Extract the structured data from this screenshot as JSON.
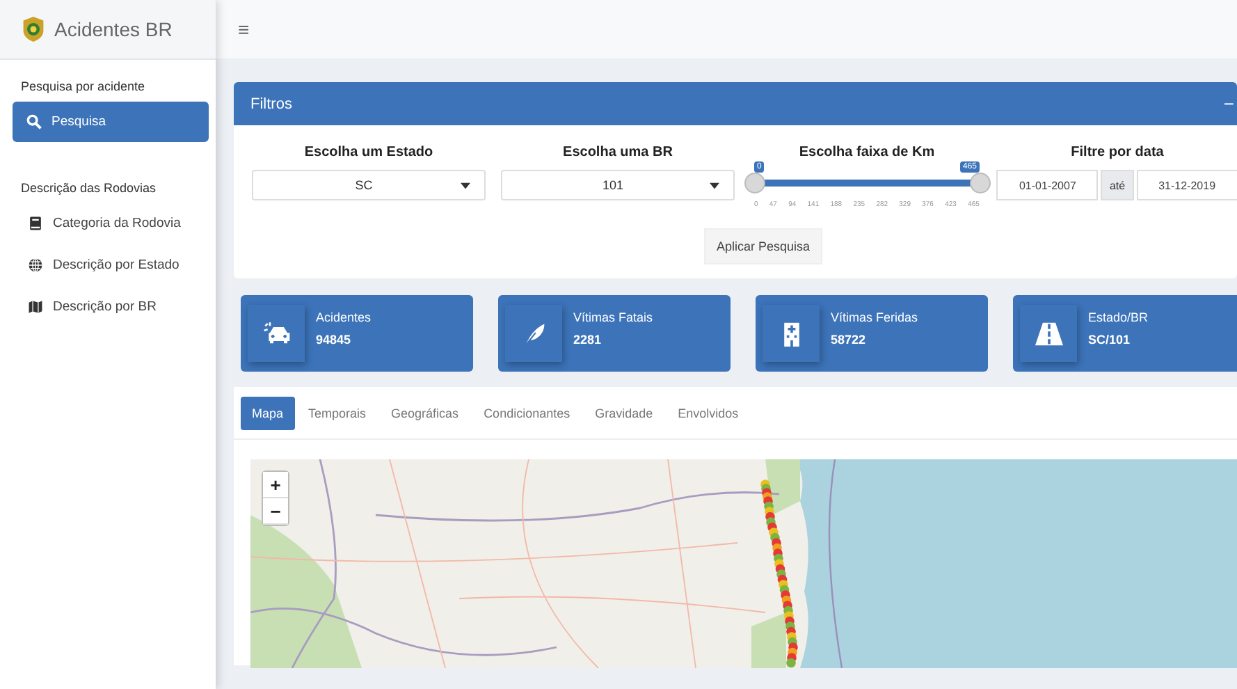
{
  "app": {
    "title": "Acidentes BR",
    "menu_icon": "≡"
  },
  "sidebar": {
    "items": [
      {
        "kind": "header",
        "label": "Pesquisa por acidente"
      },
      {
        "kind": "item",
        "label": "Pesquisa",
        "selected": true
      },
      {
        "kind": "header",
        "label": "Descrição das Rodovias"
      },
      {
        "kind": "item",
        "label": "Categoria da Rodovia",
        "selected": false
      },
      {
        "kind": "item",
        "label": "Descrição por Estado",
        "selected": false
      },
      {
        "kind": "item",
        "label": "Descrição por BR",
        "selected": false
      }
    ]
  },
  "filters": {
    "title": "Filtros",
    "collapse": "−",
    "estado": {
      "label": "Escolha um Estado",
      "value": "SC"
    },
    "br": {
      "label": "Escolha uma BR",
      "value": "101"
    },
    "km": {
      "label": "Escolha faixa de Km",
      "min_label": "0",
      "max_label": "465",
      "handles": [
        {
          "level": 0
        },
        {
          "level": 1
        }
      ],
      "ticks": [
        "0",
        "47",
        "94",
        "141",
        "188",
        "235",
        "282",
        "329",
        "376",
        "423",
        "465"
      ]
    },
    "data": {
      "label": "Filtre por data",
      "from": "01-01-2007",
      "sep": "até",
      "to": "31-12-2019"
    },
    "button": "Aplicar Pesquisa"
  },
  "stats": [
    {
      "label": "Acidentes",
      "value": "94845"
    },
    {
      "label": "Vítimas Fatais",
      "value": "2281"
    },
    {
      "label": "Vítimas Feridas",
      "value": "58722"
    },
    {
      "label": "Estado/BR",
      "value": "SC/101"
    }
  ],
  "tabs": [
    {
      "label": "Mapa",
      "selected": true
    },
    {
      "label": "Temporais",
      "selected": false
    },
    {
      "label": "Geográficas",
      "selected": false
    },
    {
      "label": "Condicionantes",
      "selected": false
    },
    {
      "label": "Gravidade",
      "selected": false
    },
    {
      "label": "Envolvidos",
      "selected": false
    }
  ],
  "map": {
    "zoom_in": "+",
    "zoom_out": "−"
  }
}
